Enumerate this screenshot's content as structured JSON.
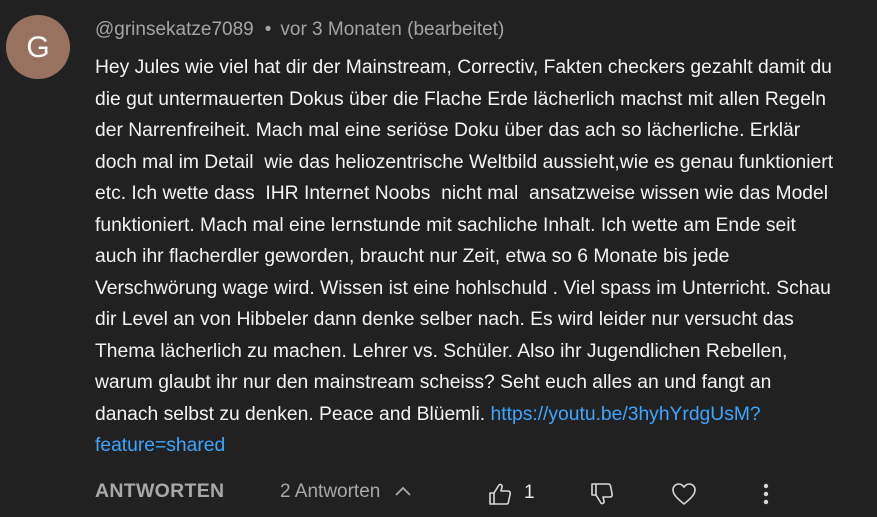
{
  "comment": {
    "avatar_initial": "G",
    "author": "@grinsekatze7089",
    "separator": "•",
    "timestamp": "vor 3 Monaten (bearbeitet)",
    "lines": [
      "Hey Jules wie viel hat dir der Mainstream, Correctiv, Fakten checkers gezahlt damit du",
      "die gut untermauerten Dokus über die Flache Erde lächerlich machst mit allen Regeln",
      "der Narrenfreiheit. Mach mal eine seriöse Doku über das ach so lächerliche. Erklär",
      "doch mal im Detail  wie das heliozentrische Weltbild aussieht,wie es genau funktioniert",
      "etc. Ich wette dass  IHR Internet Noobs  nicht mal  ansatzweise wissen wie das Model",
      "funktioniert. Mach mal eine lernstunde mit sachliche Inhalt. Ich wette am Ende seit",
      "auch ihr flacherdler geworden, braucht nur Zeit, etwa so 6 Monate bis jede",
      "Verschwörung wage wird. Wissen ist eine hohlschuld . Viel spass im Unterricht. Schau",
      "dir Level an von Hibbeler dann denke selber nach. Es wird leider nur versucht das",
      "Thema lächerlich zu machen. Lehrer vs. Schüler. Also ihr Jugendlichen Rebellen,",
      "warum glaubt ihr nur den mainstream scheiss? Seht euch alles an und fangt an"
    ],
    "last_line_text": "danach selbst zu denken. Peace and Blüemli. ",
    "link_part1": "https://youtu.be/3hyhYrdgUsM?",
    "link_part2": "feature=shared"
  },
  "actions": {
    "reply_label": "ANTWORTEN",
    "replies_label": "2 Antworten",
    "like_count": "1",
    "icons": [
      "thumb-up-icon",
      "thumb-down-icon",
      "heart-icon",
      "more-vertical-icon",
      "chevron-up-icon"
    ]
  },
  "colors": {
    "background": "#212121",
    "text": "#f3f3f3",
    "secondary": "#a4a4a4",
    "link": "#3ea6ff",
    "avatar": "#98725f"
  }
}
